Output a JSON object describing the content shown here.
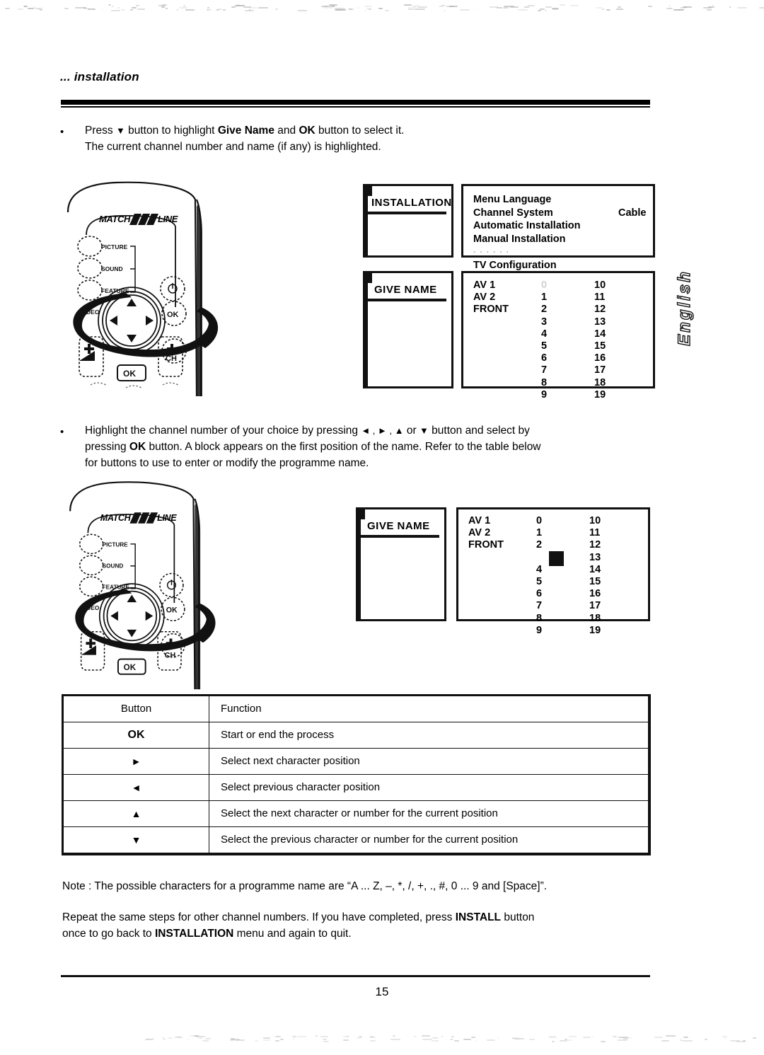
{
  "header": {
    "kicker": "... installation"
  },
  "steps": [
    {
      "bullet": "•",
      "lines": [
        [
          {
            "t": "Press "
          },
          {
            "t": "▼",
            "b": false,
            "arrow": true
          },
          {
            "t": " button to highlight "
          },
          {
            "t": "Give Name",
            "b": true
          },
          {
            "t": " and "
          },
          {
            "t": "OK",
            "b": true
          },
          {
            "t": " button to select it."
          }
        ],
        [
          {
            "t": "The current channel number and name (if any) is highlighted."
          }
        ]
      ]
    },
    {
      "bullet": "•",
      "lines": [
        [
          {
            "t": "Highlight the channel number of your choice by pressing "
          },
          {
            "t": "◄ , ► , ▲",
            "arrow": true
          },
          {
            "t": " or "
          },
          {
            "t": "▼",
            "arrow": true
          },
          {
            "t": " button and select by"
          }
        ],
        [
          {
            "t": "pressing  "
          },
          {
            "t": "OK",
            "b": true
          },
          {
            "t": "  button. A block appears on the first position of the name. Refer to the table below"
          }
        ],
        [
          {
            "t": "for buttons to use to enter or modify the programme name."
          }
        ]
      ]
    }
  ],
  "remote": {
    "brand_left": "MATCH",
    "brand_right": "LINE",
    "labels": {
      "picture": "PICTURE",
      "sound": "SOUND",
      "feature": "FEATURE",
      "video": "VIDEO",
      "ok": "OK",
      "ch": "CH",
      "ok_small": "OK"
    }
  },
  "screens": {
    "installation": {
      "title": "INSTALLATION",
      "items": [
        {
          "label": "Menu Language",
          "value": ""
        },
        {
          "label": "Channel System",
          "value": "Cable"
        },
        {
          "label": "Automatic Installation",
          "value": ""
        },
        {
          "label": "Manual Installation",
          "value": ""
        }
      ],
      "faint_row": "· · · · · ·",
      "last_item": "TV Configuration"
    },
    "givename_1": {
      "title": "GIVE NAME",
      "sources": [
        "AV 1",
        "AV 2",
        "FRONT"
      ],
      "numbers_mid": [
        "0",
        "1",
        "2",
        "3",
        "4",
        "5",
        "6",
        "7",
        "8",
        "9"
      ],
      "numbers_right": [
        "10",
        "11",
        "12",
        "13",
        "14",
        "15",
        "16",
        "17",
        "18",
        "19"
      ]
    },
    "givename_2": {
      "title": "GIVE NAME",
      "sources": [
        "AV 1",
        "AV 2",
        "FRONT"
      ],
      "numbers_mid": [
        "0",
        "1",
        "2",
        "",
        "4",
        "5",
        "6",
        "7",
        "8",
        "9"
      ],
      "numbers_right": [
        "10",
        "11",
        "12",
        "13",
        "14",
        "15",
        "16",
        "17",
        "18",
        "19"
      ],
      "cursor_row_index": 3
    }
  },
  "sidebar": {
    "language_tab": "English"
  },
  "table": {
    "headers": [
      "Button",
      "Function"
    ],
    "rows": [
      {
        "button": "OK",
        "function": "Start or end the process"
      },
      {
        "button": "►",
        "function": "Select next character position"
      },
      {
        "button": "◄",
        "function": "Select previous character position"
      },
      {
        "button": "▲",
        "function": "Select the next character or number for the current position"
      },
      {
        "button": "▼",
        "function": "Select the previous character or number for the current position"
      }
    ]
  },
  "notes": {
    "note_line": "Note : The possible characters for a programme name are “A ... Z, –, *, /, +, ., #, 0 ... 9 and [Space]”.",
    "repeat_line_1_a": "Repeat the same steps for other channel numbers. If you have completed, press ",
    "repeat_line_1_b": "INSTALL",
    "repeat_line_1_c": " button",
    "repeat_line_2_a": "once to go back to  ",
    "repeat_line_2_b": "INSTALLATION",
    "repeat_line_2_c": "  menu and again to quit."
  },
  "footer": {
    "page_number": "15"
  }
}
